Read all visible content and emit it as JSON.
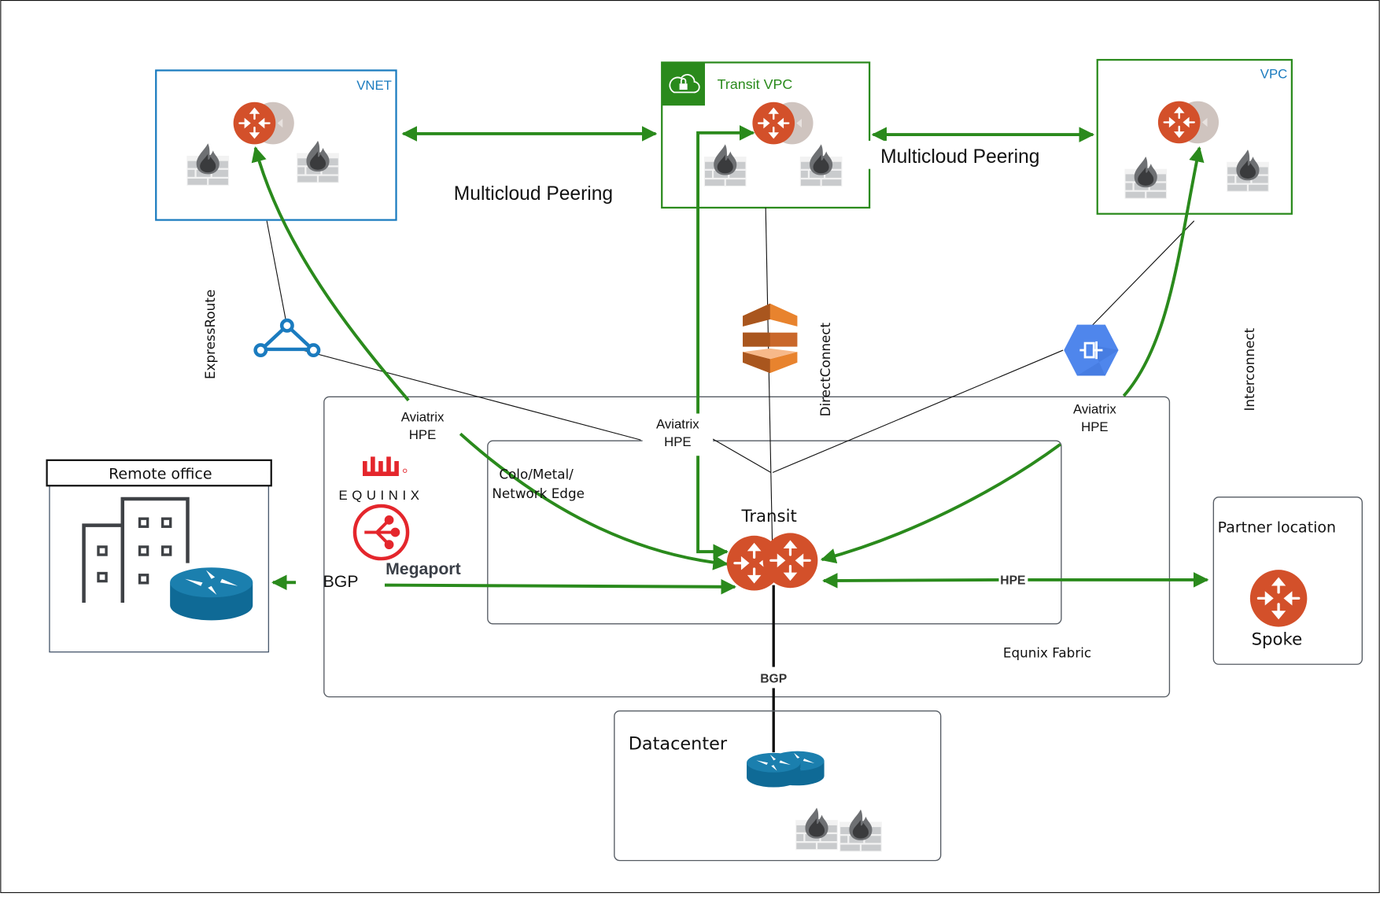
{
  "colors": {
    "green": "#2a8a1c",
    "azure_blue": "#1a7bbf",
    "router_orange": "#d3502a",
    "router_ghost": "#c9bdb8",
    "cisco_blue": "#0f6a96",
    "equinix_red": "#e4262c",
    "gcp_blue": "#4f86ec",
    "aws_orange": "#e8832e"
  },
  "clouds": {
    "vnet": {
      "label": "VNET",
      "icons": [
        "router-icon",
        "firewall-icon",
        "firewall-icon"
      ]
    },
    "transit_vpc": {
      "label": "Transit VPC",
      "badge_icon": "cloud-lock-icon",
      "icons": [
        "router-icon",
        "firewall-icon",
        "firewall-icon"
      ]
    },
    "vpc": {
      "label": "VPC",
      "icons": [
        "router-icon",
        "firewall-icon",
        "firewall-icon"
      ]
    }
  },
  "peering": {
    "left_label": "Multicloud Peering",
    "right_label": "Multicloud Peering"
  },
  "connections": {
    "expressroute": {
      "label": "ExpressRoute",
      "icon": "expressroute-icon"
    },
    "directconnect": {
      "label": "DirectConnect",
      "icon": "aws-directconnect-icon"
    },
    "interconnect": {
      "label": "Interconnect",
      "icon": "gcp-interconnect-icon"
    }
  },
  "hpe_labels": {
    "left": {
      "line1": "Aviatrix",
      "line2": "HPE"
    },
    "center": {
      "line1": "Aviatrix",
      "line2": "HPE"
    },
    "right": {
      "line1": "Aviatrix",
      "line2": "HPE"
    }
  },
  "fabric": {
    "label": "Equnix Fabric",
    "inner_label_line1": "Colo/Metal/",
    "inner_label_line2": "Network Edge",
    "equinix_text": "EQUINIX",
    "megaport_text": "Megaport",
    "transit_label": "Transit"
  },
  "remote_office": {
    "title": "Remote office",
    "bgp_label": "BGP"
  },
  "partner": {
    "title": "Partner location",
    "spoke_label": "Spoke",
    "link_label": "HPE"
  },
  "datacenter": {
    "title": "Datacenter",
    "bgp_label": "BGP"
  }
}
